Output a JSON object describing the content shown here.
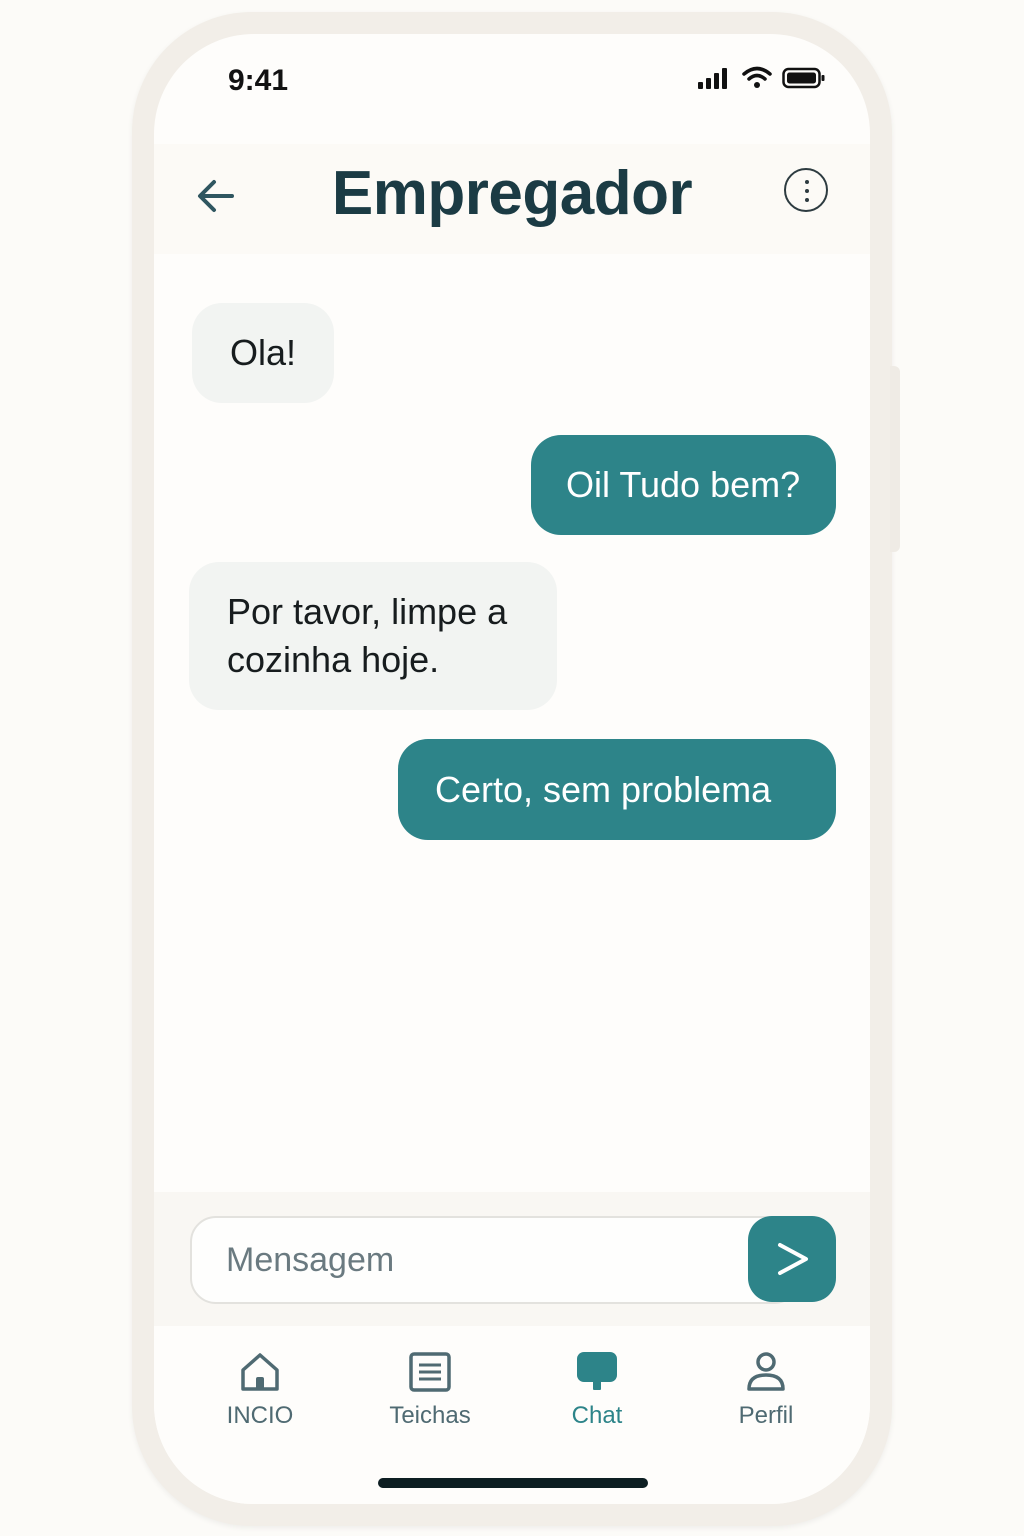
{
  "status_bar": {
    "time": "9:41"
  },
  "header": {
    "title": "Empregador"
  },
  "messages": [
    {
      "side": "received",
      "text": "Ola!"
    },
    {
      "side": "sent",
      "text": "Oil Tudo bem?"
    },
    {
      "side": "received",
      "text": "Por tavor, limpe a cozinha hoje."
    },
    {
      "side": "sent",
      "text": "Certo, sem problema"
    }
  ],
  "composer": {
    "placeholder": "Mensagem",
    "value": ""
  },
  "tabs": [
    {
      "label": "INCIO",
      "icon": "home-icon",
      "active": false
    },
    {
      "label": "Teichas",
      "icon": "list-icon",
      "active": false
    },
    {
      "label": "Chat",
      "icon": "chat-icon",
      "active": true
    },
    {
      "label": "Perfil",
      "icon": "profile-icon",
      "active": false
    }
  ],
  "colors": {
    "accent": "#2d8489",
    "title": "#1b3b44",
    "received_bubble": "#f2f4f2",
    "background": "#fefdfb"
  }
}
